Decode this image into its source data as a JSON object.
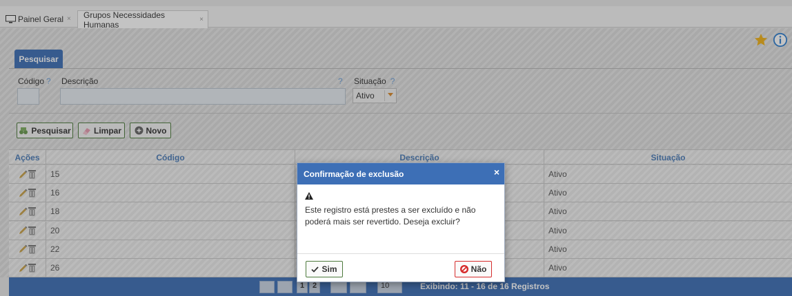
{
  "tabs": [
    {
      "label": "Painel Geral",
      "close": "×"
    },
    {
      "label": "Grupos Necessidades Humanas",
      "close": "×"
    }
  ],
  "search_panel": {
    "title": "Pesquisar",
    "fields": {
      "codigo_label": "Código",
      "descricao_label": "Descrição",
      "situacao_label": "Situação",
      "help": "?",
      "situacao_value": "Ativo"
    },
    "buttons": {
      "pesquisar": "Pesquisar",
      "limpar": "Limpar",
      "novo": "Novo"
    }
  },
  "table": {
    "headers": {
      "acoes": "Ações",
      "codigo": "Código",
      "descricao": "Descrição",
      "situacao": "Situação"
    },
    "rows": [
      {
        "codigo": "15",
        "situacao": "Ativo"
      },
      {
        "codigo": "16",
        "situacao": "Ativo"
      },
      {
        "codigo": "18",
        "situacao": "Ativo"
      },
      {
        "codigo": "20",
        "situacao": "Ativo"
      },
      {
        "codigo": "22",
        "situacao": "Ativo"
      },
      {
        "codigo": "26",
        "situacao": "Ativo"
      }
    ]
  },
  "pager": {
    "pages": [
      "1",
      "2"
    ],
    "page_size": "10",
    "summary": "Exibindo: 11 - 16 de 16 Registros"
  },
  "dialog": {
    "title": "Confirmação de exclusão",
    "close": "×",
    "warning_icon": "▲",
    "message": "Este registro está prestes a ser excluído e não poderá mais ser revertido. Deseja excluir?",
    "yes_label": "Sim",
    "no_label": "Não"
  },
  "colors": {
    "primary": "#3d6fb6",
    "star": "#f0b21a",
    "info": "#2f7fd0",
    "danger": "#d62b2b",
    "success": "#4d7a3c"
  },
  "icons": [
    "monitor-icon",
    "star-icon",
    "info-icon",
    "pencil-icon",
    "trash-icon",
    "warning-icon",
    "check-icon",
    "ban-icon"
  ]
}
